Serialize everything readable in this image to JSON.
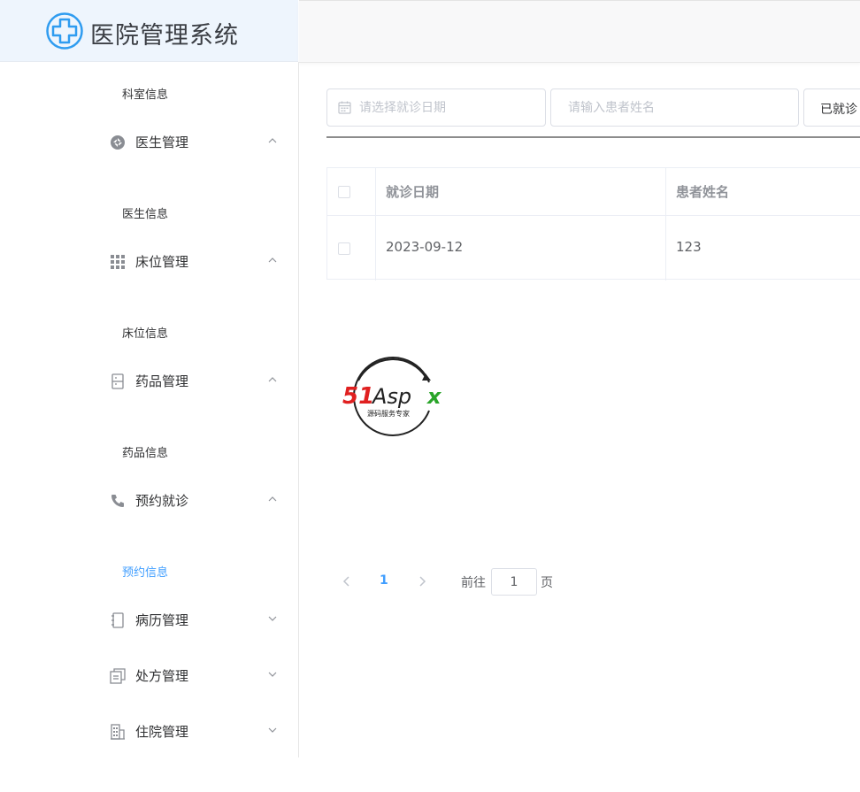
{
  "app": {
    "title": "医院管理系统"
  },
  "sidebar": {
    "items": [
      {
        "type": "sub",
        "label": "科室信息"
      },
      {
        "type": "group",
        "label": "医生管理",
        "icon": "aperture-icon",
        "expanded": true
      },
      {
        "type": "sub",
        "label": "医生信息"
      },
      {
        "type": "group",
        "label": "床位管理",
        "icon": "grid-icon",
        "expanded": true
      },
      {
        "type": "sub",
        "label": "床位信息"
      },
      {
        "type": "group",
        "label": "药品管理",
        "icon": "cabinet-icon",
        "expanded": true
      },
      {
        "type": "sub",
        "label": "药品信息"
      },
      {
        "type": "group",
        "label": "预约就诊",
        "icon": "phone-icon",
        "expanded": true
      },
      {
        "type": "sub",
        "label": "预约信息",
        "active": true
      },
      {
        "type": "group",
        "label": "病历管理",
        "icon": "notebook-icon",
        "expanded": false
      },
      {
        "type": "group",
        "label": "处方管理",
        "icon": "document-icon",
        "expanded": false
      },
      {
        "type": "group",
        "label": "住院管理",
        "icon": "building-icon",
        "expanded": false
      }
    ]
  },
  "filters": {
    "date_placeholder": "请选择就诊日期",
    "name_placeholder": "请输入患者姓名",
    "status_value": "已就诊"
  },
  "table": {
    "columns": [
      "就诊日期",
      "患者姓名"
    ],
    "rows": [
      {
        "date": "2023-09-12",
        "name": "123"
      }
    ]
  },
  "pagination": {
    "current_page": "1",
    "goto_label": "前往",
    "goto_value": "1",
    "page_label": "页"
  },
  "watermark": {
    "brand": "51Aspx",
    "tagline": "源码服务专家"
  },
  "colors": {
    "accent": "#409eff",
    "logo_bg": "#eef5fd",
    "text": "#303133",
    "placeholder": "#c0c4cc",
    "border": "#dcdfe6",
    "header_text": "#909399"
  }
}
